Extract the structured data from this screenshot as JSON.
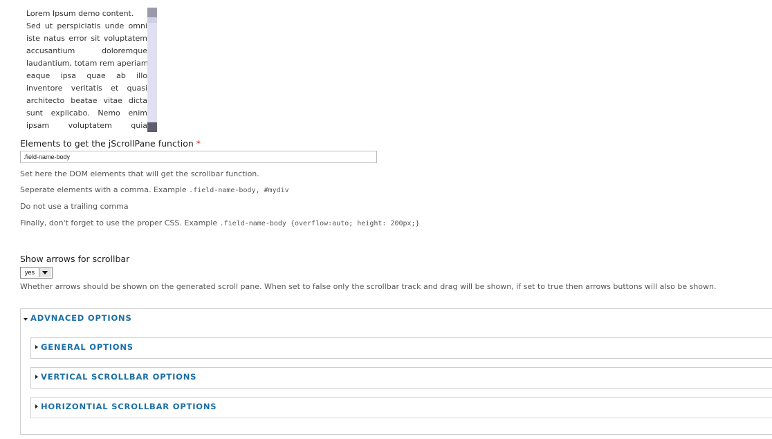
{
  "preview": {
    "lines": [
      "Lorem Ipsum demo content.",
      "Sed ut perspiciatis unde omni",
      "iste natus error sit voluptatem",
      "accusantium doloremque",
      "laudantium, totam rem aperiam",
      "eaque ipsa quae ab illo",
      "inventore veritatis et quasi",
      "architecto beatae vitae dicta",
      "sunt explicabo. Nemo enim",
      "ipsam voluptatem quia"
    ]
  },
  "elements_field": {
    "label": "Elements to get the jScrollPane function",
    "required_mark": "*",
    "value": ".field-name-body",
    "desc1": "Set here the DOM elements that will get the scrollbar function.",
    "desc2_text": "Seperate elements with a comma. Example ",
    "desc2_code": ".field-name-body, #mydiv",
    "desc3": "Do not use a trailing comma",
    "desc4_text": "Finally, don't forget to use the proper CSS. Example ",
    "desc4_code": ".field-name-body {overflow:auto; height: 200px;}"
  },
  "arrows_field": {
    "label": "Show arrows for scrollbar",
    "selected": "yes",
    "desc": "Whether arrows should be shown on the generated scroll pane. When set to false only the scrollbar track and drag will be shown, if set to true then arrows buttons will also be shown."
  },
  "fieldsets": {
    "advanced": "ADVNACED OPTIONS",
    "general": "GENERAL OPTIONS",
    "vertical": "VERTICAL SCROLLBAR OPTIONS",
    "horizontal": "HORIZONTIAL SCROLLBAR OPTIONS"
  }
}
